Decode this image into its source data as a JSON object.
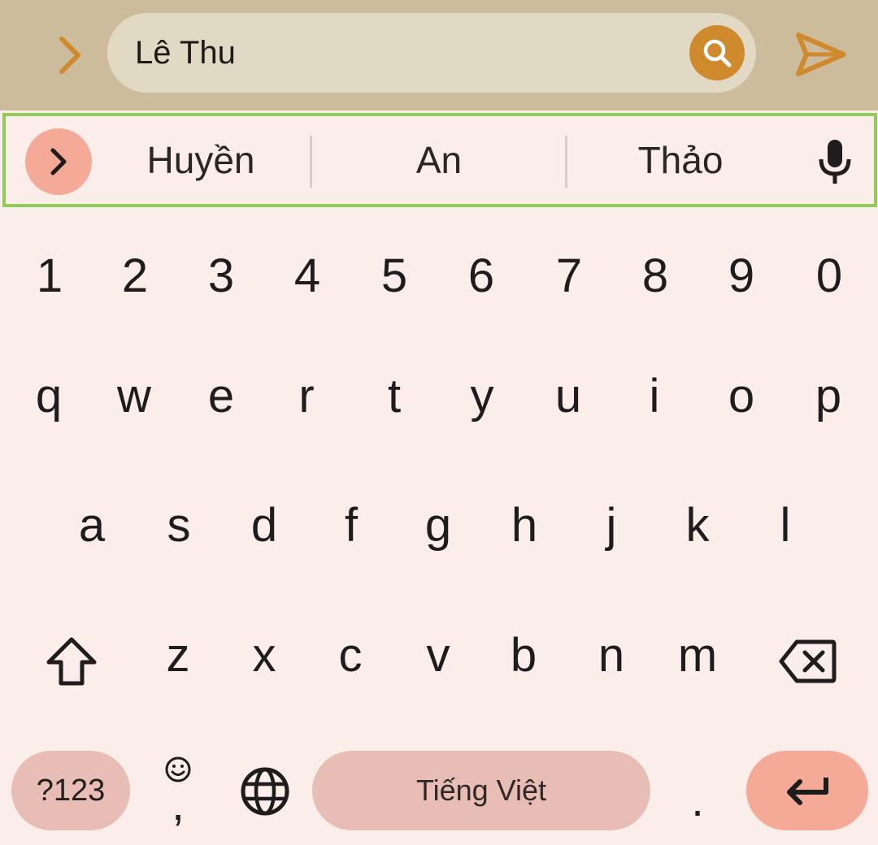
{
  "search": {
    "value": "Lê Thu"
  },
  "suggestions": [
    "Huyền",
    "An",
    "Thảo"
  ],
  "keyboard": {
    "numbers": [
      "1",
      "2",
      "3",
      "4",
      "5",
      "6",
      "7",
      "8",
      "9",
      "0"
    ],
    "row1": [
      "q",
      "w",
      "e",
      "r",
      "t",
      "y",
      "u",
      "i",
      "o",
      "p"
    ],
    "row2": [
      "a",
      "s",
      "d",
      "f",
      "g",
      "h",
      "j",
      "k",
      "l"
    ],
    "row3": [
      "z",
      "x",
      "c",
      "v",
      "b",
      "n",
      "m"
    ],
    "symbols_label": "?123",
    "comma": ",",
    "space_label": "Tiếng Việt",
    "period": "."
  },
  "colors": {
    "accent": "#d08a2e",
    "topbar": "#cdbc9c",
    "keyboard_bg": "#fbeeea",
    "key_pill": "#e7bdb5",
    "action_pill": "#f5aa98",
    "highlight_border": "#8fcc55"
  },
  "icons": [
    "expand-chevron-icon",
    "search-icon",
    "send-icon",
    "suggestions-expand-icon",
    "microphone-icon",
    "shift-icon",
    "backspace-icon",
    "emoji-icon",
    "globe-icon",
    "enter-icon"
  ]
}
